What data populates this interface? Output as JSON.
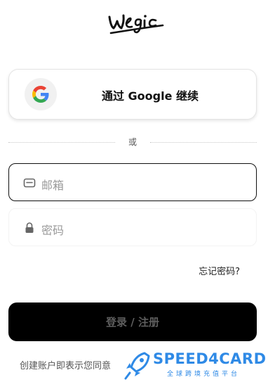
{
  "brand": {
    "logo_text": "wegic"
  },
  "google_button": {
    "label": "通过 Google 继续"
  },
  "divider": {
    "label": "或"
  },
  "email_field": {
    "placeholder": "邮箱"
  },
  "password_field": {
    "placeholder": "密码"
  },
  "forgot_link": {
    "label": "忘记密码?"
  },
  "submit_button": {
    "label": "登录 / 注册"
  },
  "terms": {
    "text": "创建账户即表示您同意"
  },
  "watermark": {
    "title": "SPEED4CARD",
    "subtitle": "全球跨境充值平台",
    "color": "#2f8ae6"
  }
}
